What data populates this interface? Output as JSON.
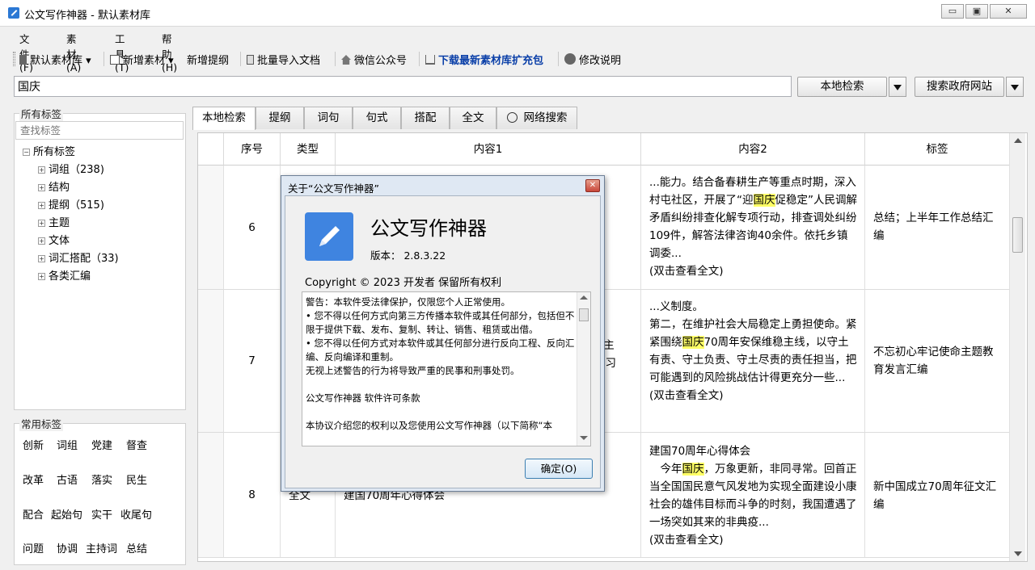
{
  "window": {
    "title": "公文写作神器 - 默认素材库",
    "minimize": "▭",
    "restore": "▣",
    "close": "✕"
  },
  "menu": [
    "文件(F)",
    "素材(A)",
    "工具(T)",
    "帮助(H)"
  ],
  "toolbar": {
    "library": "默认素材库",
    "new_material": "新增素材",
    "new_outline": "新增提纲",
    "batch_import": "批量导入文档",
    "wechat": "微信公众号",
    "download": "下载最新素材库扩充包",
    "changelog": "修改说明"
  },
  "search": {
    "value": "国庆",
    "local_btn": "本地检索",
    "gov_btn": "搜索政府网站"
  },
  "left_panel": {
    "title": "所有标签",
    "search_placeholder": "查找标签",
    "root": "所有标签",
    "nodes": [
      "词组（238)",
      "结构",
      "提纲（515)",
      "主题",
      "文体",
      "词汇搭配（33)",
      "各类汇编"
    ]
  },
  "common_tags": {
    "title": "常用标签",
    "items": [
      "创新",
      "词组",
      "党建",
      "督查",
      "改革",
      "古语",
      "落实",
      "民生",
      "配合",
      "起始句",
      "实干",
      "收尾句",
      "问题",
      "协调",
      "主持词",
      "总结"
    ]
  },
  "tabs": [
    "本地检索",
    "提纲",
    "词句",
    "句式",
    "搭配",
    "全文",
    "网络搜索"
  ],
  "grid": {
    "headers": [
      "序号",
      "类型",
      "内容1",
      "内容2",
      "标签"
    ],
    "rows": [
      {
        "num": "6",
        "c2": {
          "a": "...能力。结合备春耕生产等重点时期，深入村屯社区，开展了“迎",
          "hl": "国庆",
          "b": "促稳定”人民调解矛盾纠纷排查化解专项行动，排查调处纠纷109件，解答法律咨询40余件。依托乡镇调委..."
        },
        "c2_more": "(双击查看全文)",
        "tag": "总结；上半年工作总结汇编"
      },
      {
        "num": "7",
        "c1_frag": "” 主\n学习",
        "c2": {
          "a": "...义制度。\n第二，在维护社会大局稳定上勇担使命。紧紧围绕",
          "hl": "国庆",
          "b": "70周年安保维稳主线，以守土有责、守土负责、守土尽责的责任担当，把可能遇到的风险挑战估计得更充分一些..."
        },
        "c2_more": "(双击查看全文)",
        "tag": "不忘初心牢记使命主题教育发言汇编"
      },
      {
        "num": "8",
        "type_frag": "全文",
        "c1_frag": "建国70周年心得体会",
        "c2": {
          "a": "建国70周年心得体会\n　今年",
          "hl": "国庆",
          "b": "，万象更新，非同寻常。回首正当全国国民意气风发地为实现全面建设小康社会的雄伟目标而斗争的时刻，我国遭遇了一场突如其来的非典疫..."
        },
        "c2_more": "(双击查看全文)",
        "tag": "新中国成立70周年征文汇编"
      }
    ]
  },
  "dialog": {
    "title": "关于“公文写作神器”",
    "app_name": "公文写作神器",
    "version": "版本： 2.8.3.22",
    "copyright": "Copyright © 2023  开发者 保留所有权利",
    "license_lines": [
      "警告：本软件受法律保护，仅限您个人正常使用。",
      "• 您不得以任何方式向第三方传播本软件或其任何部分，包括但不限于提供下载、发布、复制、转让、销售、租赁或出借。",
      "• 您不得以任何方式对本软件或其任何部分进行反向工程、反向汇编、反向编译和重制。",
      "无视上述警告的行为将导致严重的民事和刑事处罚。",
      "",
      "公文写作神器 软件许可条款",
      "",
      "本协议介绍您的权利以及您使用公文写作神器（以下简称“本"
    ],
    "ok_btn": "确定(O)"
  }
}
